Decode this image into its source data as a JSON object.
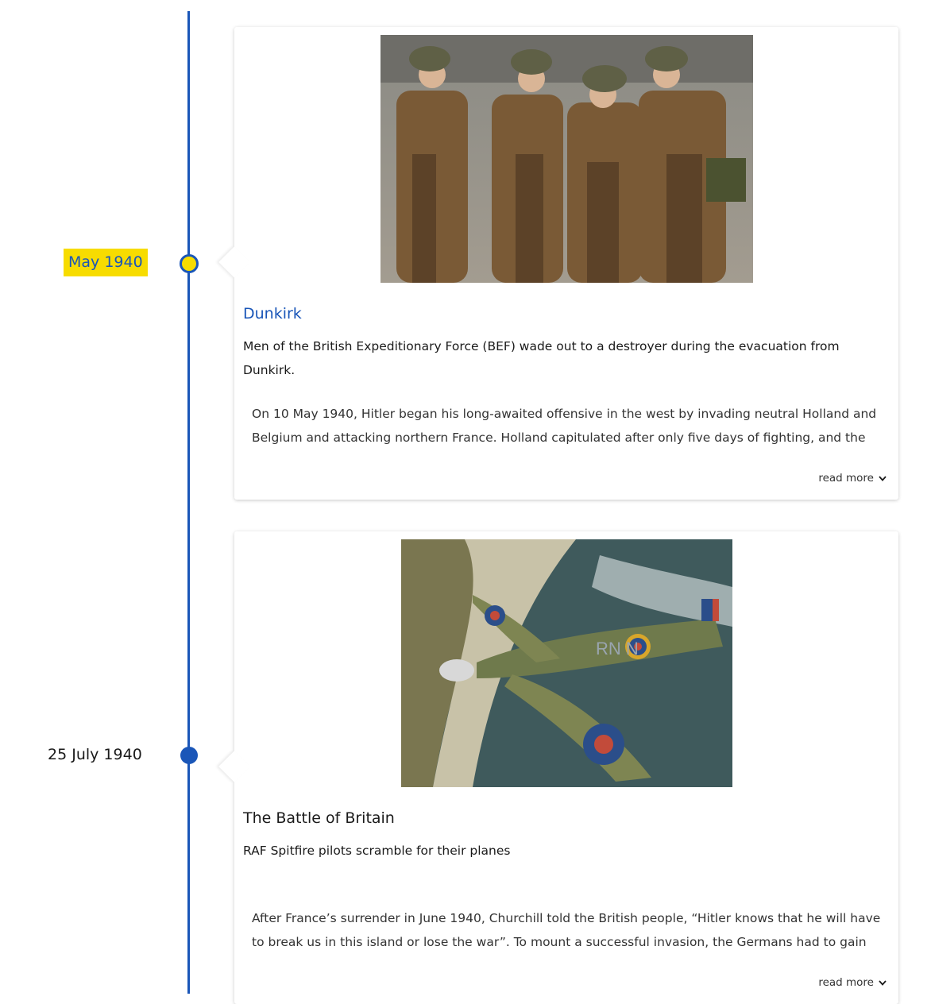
{
  "timeline": {
    "entries": [
      {
        "date": "May 1940",
        "active": true,
        "title": "Dunkirk",
        "caption": "Men of the British Expeditionary Force (BEF) wade out to a destroyer during the evacuation from Dunkirk.",
        "excerpt": "On 10 May 1940, Hitler began his long-awaited offensive in the west by invading neutral Holland and Belgium and attacking northern France. Holland capitulated after only five days of fighting, and the",
        "read_more": "read more",
        "image_icon": "soldiers-photo"
      },
      {
        "date": "25 July 1940",
        "active": false,
        "title": "The Battle of Britain",
        "caption": "RAF Spitfire pilots scramble for their planes",
        "excerpt": "After France’s surrender in June 1940, Churchill told the British people, “Hitler knows that he will have to break us in this island or lose the war”. To mount a successful invasion, the Germans had to gain air",
        "read_more": "read more",
        "image_icon": "spitfire-photo",
        "plane_marking": "RN N"
      }
    ]
  },
  "colors": {
    "accent": "#1a56b8",
    "highlight": "#f7dc00"
  }
}
